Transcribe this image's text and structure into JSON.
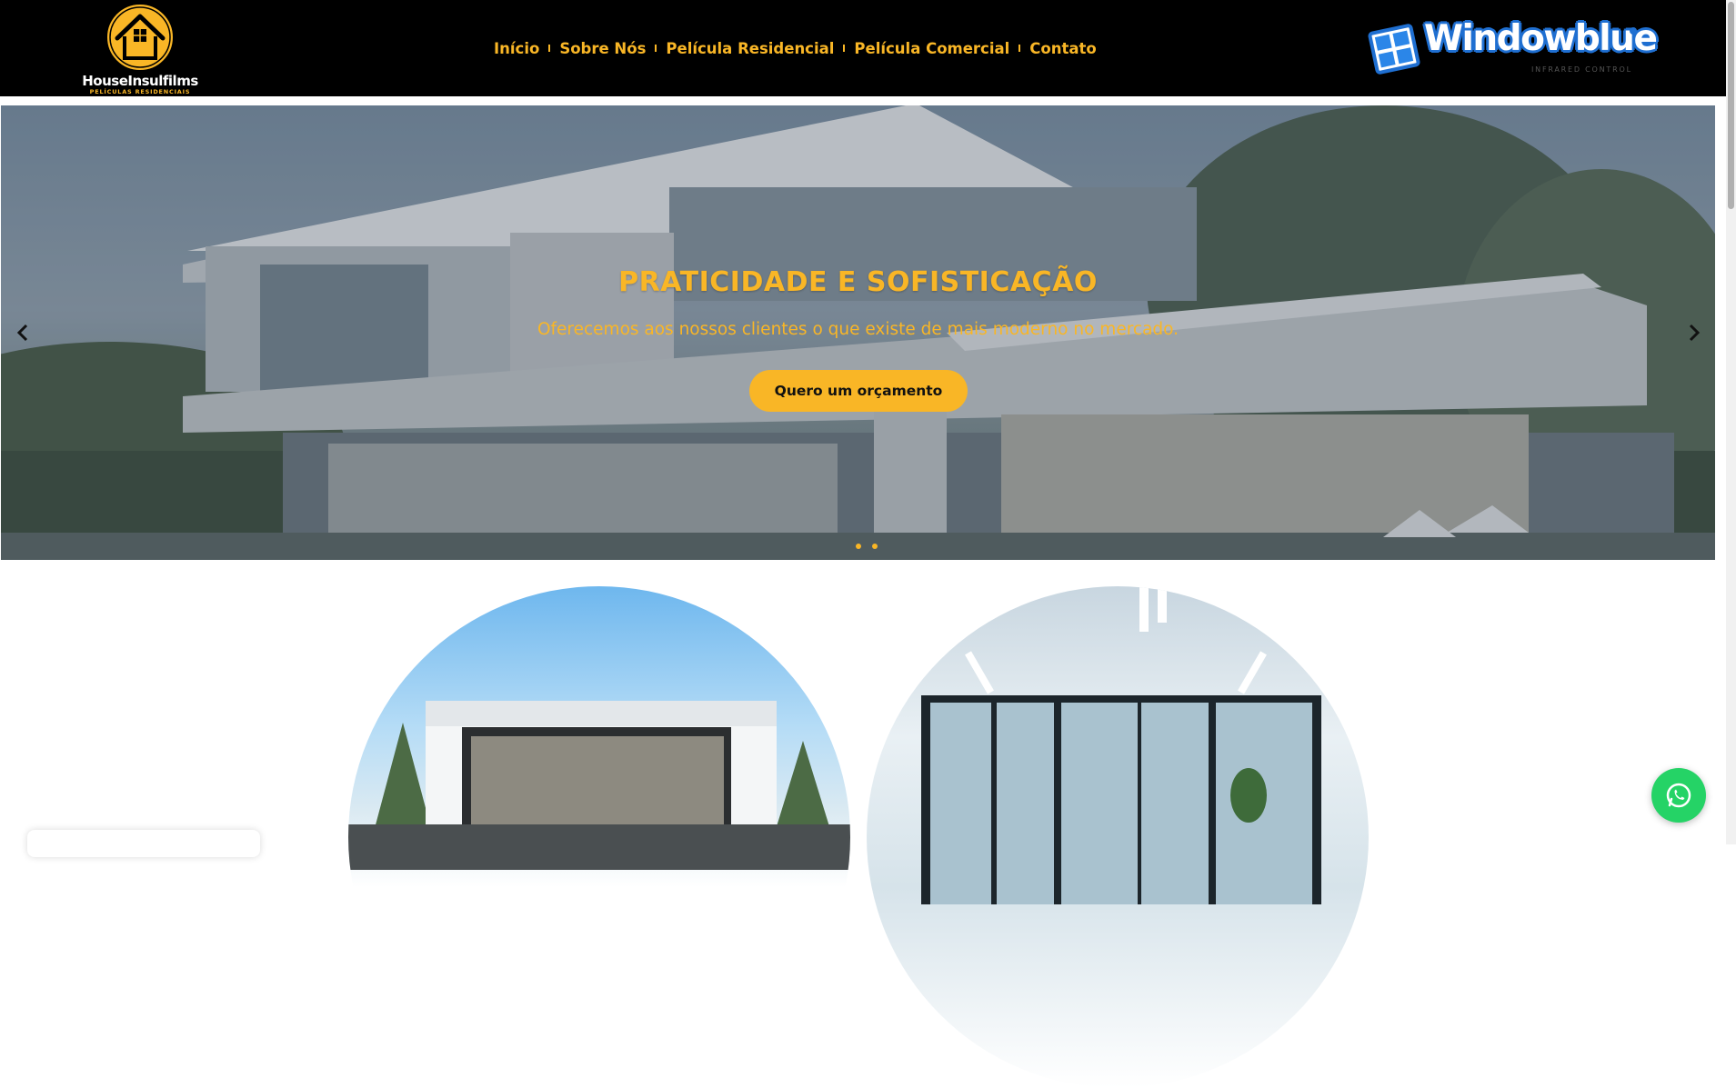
{
  "header": {
    "brand": {
      "name": "HouseInsulfilms",
      "tagline": "PELÍCULAS RESIDENCIAIS"
    },
    "nav": [
      {
        "label": "Início"
      },
      {
        "label": "Sobre Nós"
      },
      {
        "label": "Película Residencial"
      },
      {
        "label": "Película Comercial"
      },
      {
        "label": "Contato"
      }
    ],
    "partner": {
      "name": "Windowblue",
      "tagline": "INFRARED CONTROL"
    }
  },
  "hero": {
    "title": "PRATICIDADE E SOFISTICAÇÃO",
    "subtitle": "Oferecemos aos nossos clientes o que existe de mais moderno no mercado.",
    "cta": "Quero um orçamento",
    "slide_count": 2
  },
  "colors": {
    "accent": "#f9b626",
    "header_bg": "#000000",
    "partner_blue": "#1f6fd1",
    "whatsapp": "#25d366"
  },
  "icons": {
    "prev": "chevron-left-icon",
    "next": "chevron-right-icon",
    "whatsapp": "whatsapp-icon"
  }
}
